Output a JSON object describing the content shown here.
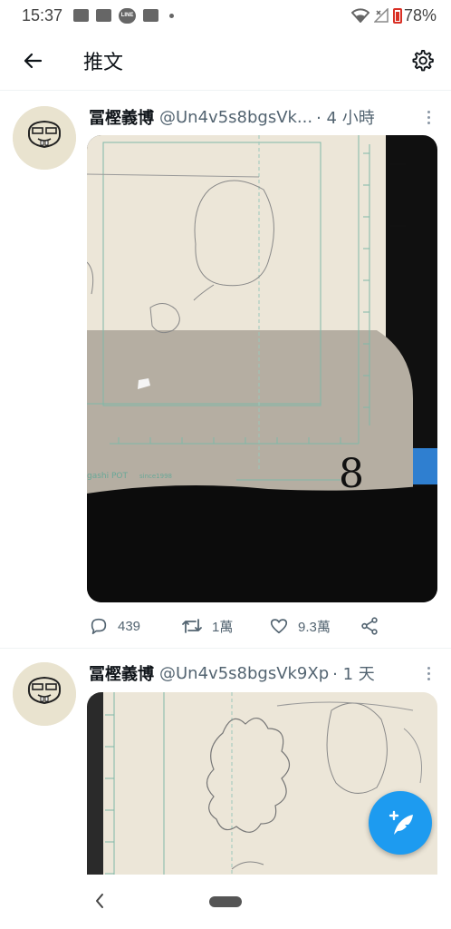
{
  "status_bar": {
    "time": "15:37",
    "battery": "78%",
    "line_label": "LINE",
    "icons": [
      "image-icon",
      "news-icon",
      "line-icon",
      "mail-icon",
      "dot-icon",
      "wifi-icon",
      "signal-icon",
      "battery-icon"
    ]
  },
  "header": {
    "title": "推文",
    "back_icon": "arrow-left-icon",
    "settings_icon": "gear-icon"
  },
  "tweets": [
    {
      "name": "冨樫義博",
      "handle": "@Un4v5s8bgsVk...",
      "time": "· 4 小時",
      "reply_count": "439",
      "retweet_count": "1萬",
      "like_count": "9.3萬",
      "photo_texts": [
        "gashi POT",
        "since1998",
        "8"
      ]
    },
    {
      "name": "冨樫義博",
      "handle": "@Un4v5s8bgsVk9Xp",
      "time": "· 1 天"
    }
  ],
  "colors": {
    "accent": "#1d9bf0",
    "text": "#0f1419",
    "secondary": "#536471",
    "battery": "#d93025"
  }
}
